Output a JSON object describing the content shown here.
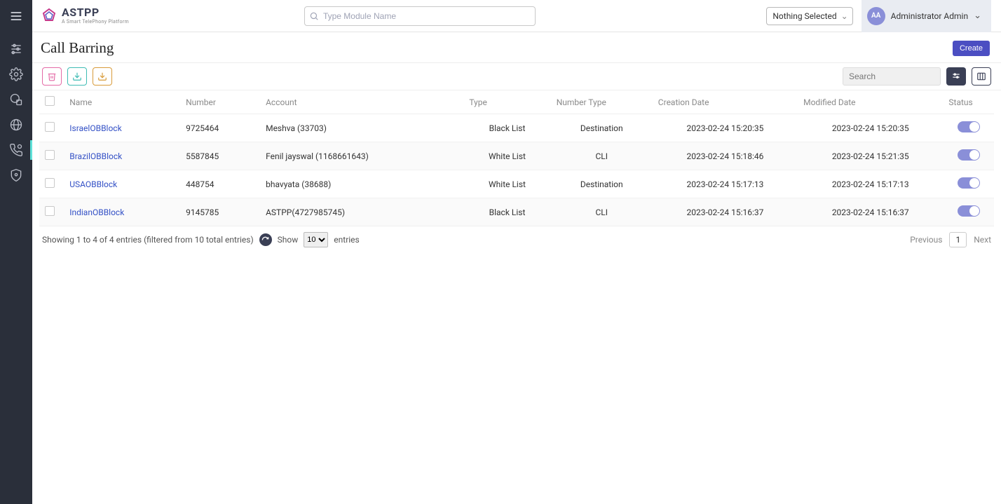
{
  "brand": {
    "name": "ASTPP",
    "tagline": "A Smart TelePhony Platform"
  },
  "header": {
    "search_placeholder": "Type Module Name",
    "selector_label": "Nothing Selected",
    "avatar_initials": "AA",
    "user_name": "Administrator Admin"
  },
  "page": {
    "title": "Call Barring",
    "create_label": "Create"
  },
  "toolbar": {
    "search_placeholder": "Search"
  },
  "columns": {
    "name": "Name",
    "number": "Number",
    "account": "Account",
    "type": "Type",
    "number_type": "Number Type",
    "creation_date": "Creation Date",
    "modified_date": "Modified Date",
    "status": "Status"
  },
  "rows": [
    {
      "name": "IsraelOBBlock",
      "number": "9725464",
      "account": "Meshva (33703)",
      "type": "Black List",
      "number_type": "Destination",
      "created": "2023-02-24 15:20:35",
      "modified": "2023-02-24 15:20:35"
    },
    {
      "name": "BrazilOBBlock",
      "number": "5587845",
      "account": "Fenil jayswal (1168661643)",
      "type": "White List",
      "number_type": "CLI",
      "created": "2023-02-24 15:18:46",
      "modified": "2023-02-24 15:21:35"
    },
    {
      "name": "USAOBBlock",
      "number": "448754",
      "account": "bhavyata (38688)",
      "type": "White List",
      "number_type": "Destination",
      "created": "2023-02-24 15:17:13",
      "modified": "2023-02-24 15:17:13"
    },
    {
      "name": "IndianOBBlock",
      "number": "9145785",
      "account": "ASTPP(4727985745)",
      "type": "Black List",
      "number_type": "CLI",
      "created": "2023-02-24 15:16:37",
      "modified": "2023-02-24 15:16:37"
    }
  ],
  "footer": {
    "info": "Showing 1 to 4 of 4 entries (filtered from 10 total entries)",
    "show_label": "Show",
    "entries_label": "entries",
    "page_size": "10",
    "prev": "Previous",
    "next": "Next",
    "current_page": "1"
  }
}
